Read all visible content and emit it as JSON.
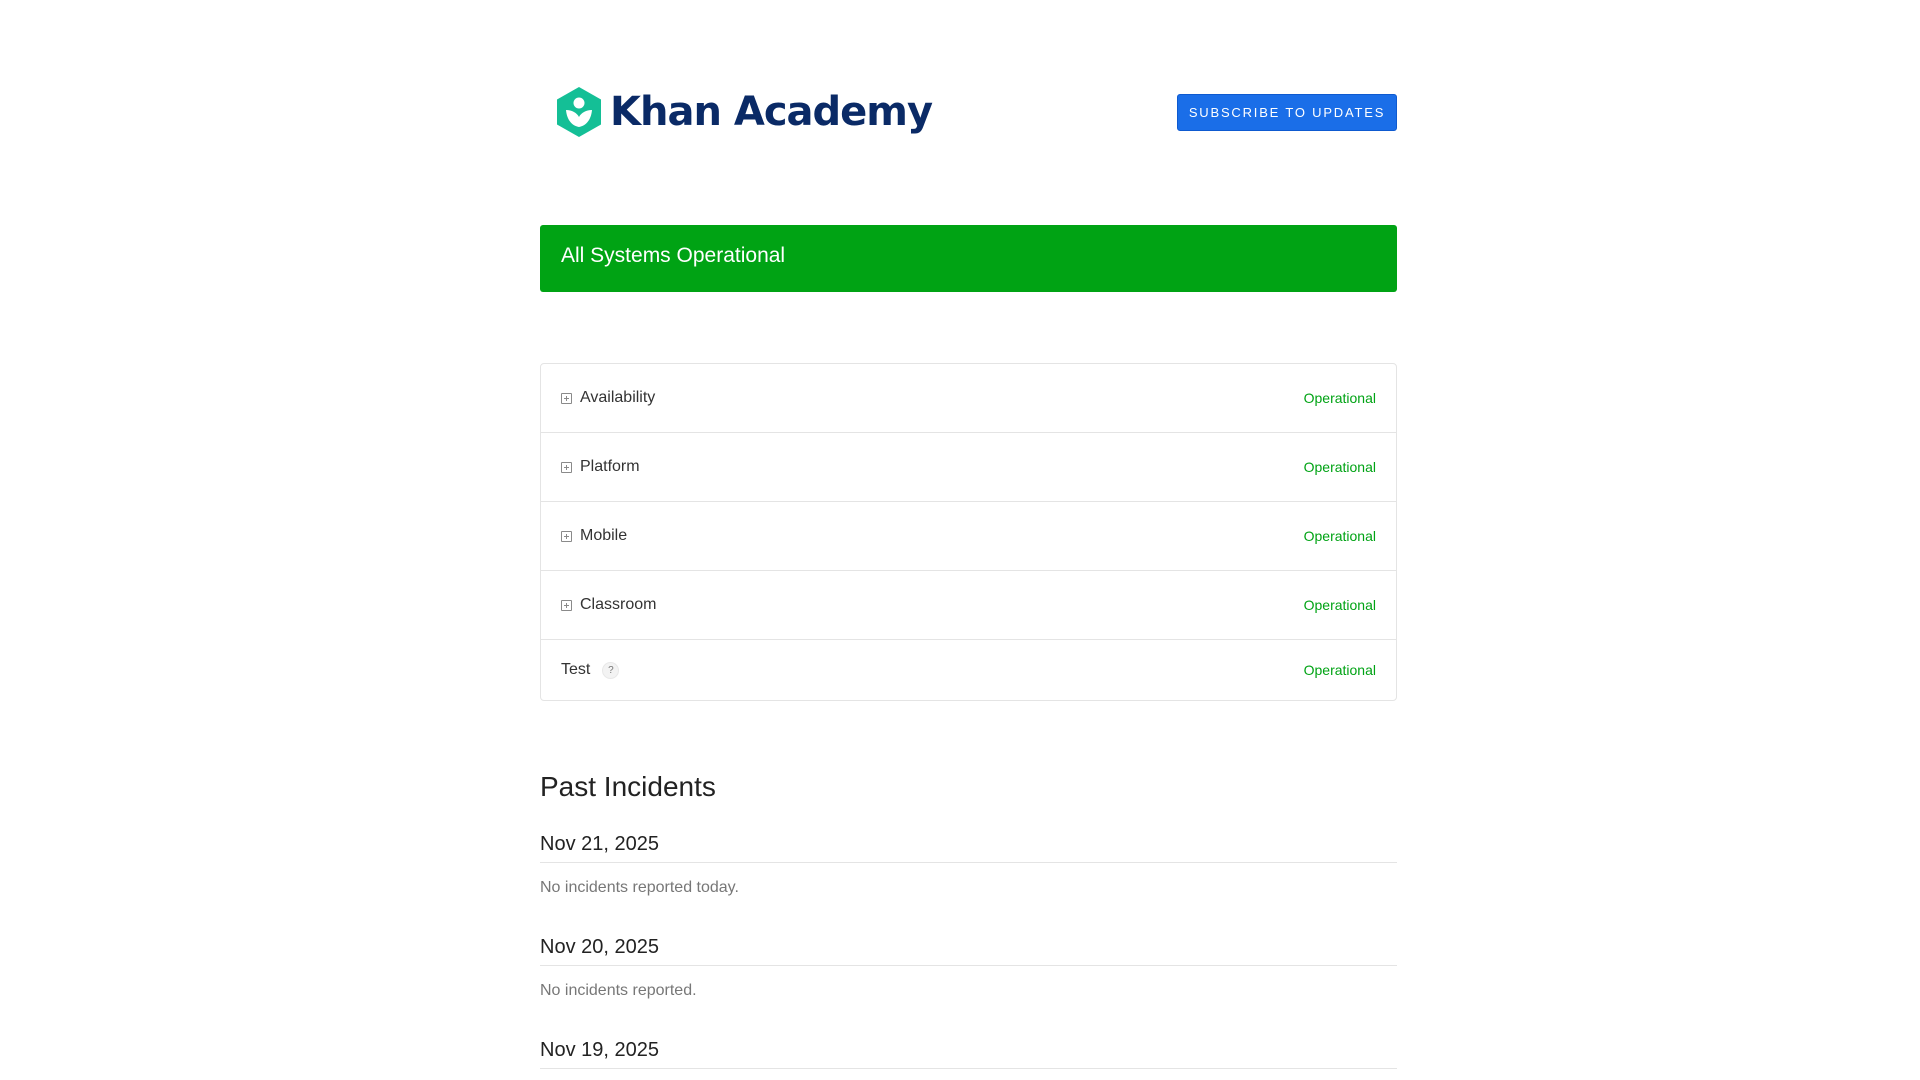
{
  "header": {
    "logo_text": "Khan Academy",
    "subscribe_label": "SUBSCRIBE TO UPDATES"
  },
  "banner": {
    "status": "All Systems Operational",
    "color": "#00a314"
  },
  "components": [
    {
      "name": "Availability",
      "status": "Operational",
      "expandable": true
    },
    {
      "name": "Platform",
      "status": "Operational",
      "expandable": true
    },
    {
      "name": "Mobile",
      "status": "Operational",
      "expandable": true
    },
    {
      "name": "Classroom",
      "status": "Operational",
      "expandable": true
    },
    {
      "name": "Test",
      "status": "Operational",
      "expandable": false,
      "help": "?"
    }
  ],
  "past_incidents": {
    "title": "Past Incidents",
    "days": [
      {
        "date": "Nov 21, 2025",
        "text": "No incidents reported today."
      },
      {
        "date": "Nov 20, 2025",
        "text": "No incidents reported."
      },
      {
        "date": "Nov 19, 2025",
        "text": ""
      }
    ]
  },
  "colors": {
    "brand_blue": "#1a6ee8",
    "operational_green": "#00a314",
    "logo_teal": "#14bf96",
    "logo_navy": "#0a2a66",
    "incident_orange": "#e8630a"
  }
}
